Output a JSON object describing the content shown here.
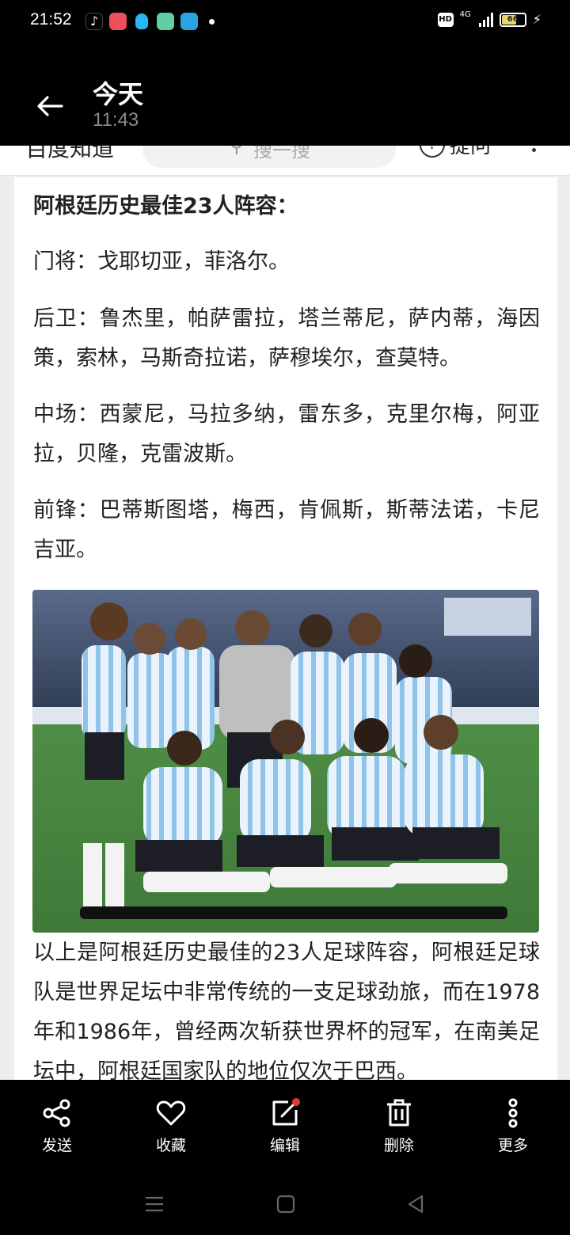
{
  "status_bar": {
    "time": "21:52",
    "network": "4G",
    "battery": "66"
  },
  "header": {
    "title": "今天",
    "subtitle": "11:43"
  },
  "underlying_page": {
    "logo": "百度知道",
    "search_placeholder": "搜一搜",
    "ask_label": "提问"
  },
  "article": {
    "heading": "阿根廷历史最佳23人阵容：",
    "goalkeepers": "门将：戈耶切亚，菲洛尔。",
    "defenders": "后卫：鲁杰里，帕萨雷拉，塔兰蒂尼，萨内蒂，海因策，索林，马斯奇拉诺，萨穆埃尔，查莫特。",
    "midfielders": "中场：西蒙尼，马拉多纳，雷东多，克里尔梅，阿亚拉，贝隆，克雷波斯。",
    "forwards": "前锋：巴蒂斯图塔，梅西，肯佩斯，斯蒂法诺，卡尼吉亚。",
    "summary": "以上是阿根廷历史最佳的23人足球阵容，阿根廷足球队是世界足坛中非常传统的一支足球劲旅，而在1978年和1986年，曾经两次斩获世界杯的冠军，在南美足坛中，阿根廷国家队的地位仅次于巴西。"
  },
  "actions": [
    {
      "label": "发送",
      "icon": "share-icon"
    },
    {
      "label": "收藏",
      "icon": "heart-icon"
    },
    {
      "label": "编辑",
      "icon": "edit-icon"
    },
    {
      "label": "删除",
      "icon": "trash-icon"
    },
    {
      "label": "更多",
      "icon": "more-vertical-icon"
    }
  ],
  "colors": {
    "background_dark": "#000000",
    "content_bg": "#ffffff",
    "text": "#222222",
    "edit_badge": "#e53935"
  }
}
